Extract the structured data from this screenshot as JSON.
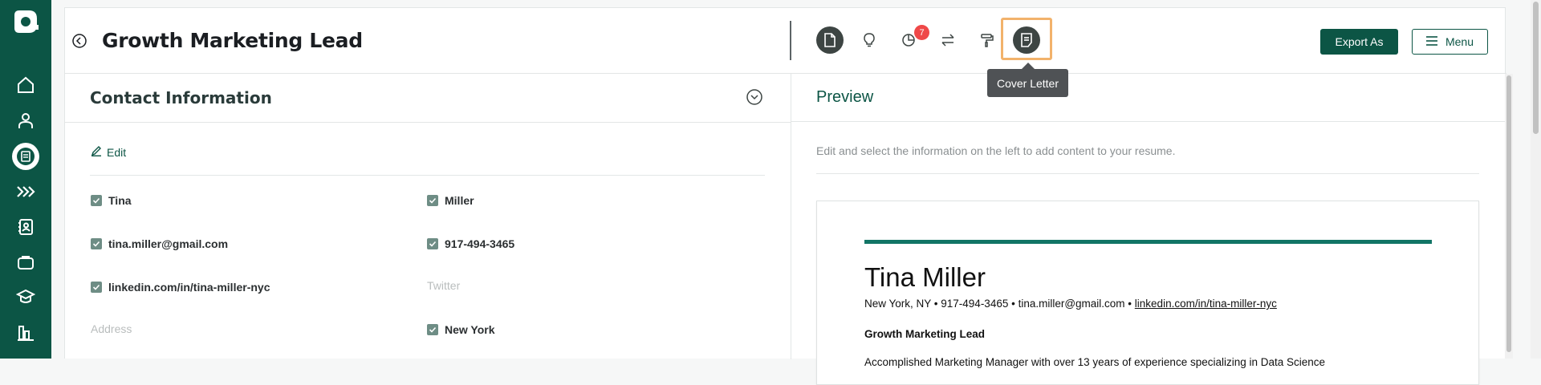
{
  "sidebar": {
    "items": [
      {
        "icon": "home-icon"
      },
      {
        "icon": "user-icon"
      },
      {
        "icon": "resume-icon",
        "active": true
      },
      {
        "icon": "chevrons-right-icon"
      },
      {
        "icon": "contacts-icon"
      },
      {
        "icon": "briefcase-icon"
      },
      {
        "icon": "graduation-cap-icon"
      },
      {
        "icon": "bar-chart-icon"
      }
    ]
  },
  "header": {
    "title": "Growth Marketing Lead",
    "notification_count": "7",
    "tooltip": "Cover Letter",
    "export_label": "Export As",
    "menu_label": "Menu",
    "toolbar_icons": [
      "document-icon",
      "lightbulb-icon",
      "pie-chart-icon",
      "swap-icon",
      "paint-roller-icon",
      "cover-letter-icon"
    ]
  },
  "contact": {
    "section_title": "Contact Information",
    "edit_label": "Edit",
    "first_name": "Tina",
    "last_name": "Miller",
    "email": "tina.miller@gmail.com",
    "phone": "917-494-3465",
    "linkedin": "linkedin.com/in/tina-miller-nyc",
    "twitter_placeholder": "Twitter",
    "address_placeholder": "Address",
    "city": "New York"
  },
  "preview": {
    "title": "Preview",
    "hint": "Edit and select the information on the left to add content to your resume.",
    "resume": {
      "name": "Tina Miller",
      "contact_prefix": "New York, NY • 917-494-3465 • tina.miller@gmail.com • ",
      "contact_link": "linkedin.com/in/tina-miller-nyc",
      "role": "Growth Marketing Lead",
      "summary": "Accomplished Marketing Manager with over 13 years of experience specializing in Data Science"
    }
  },
  "colors": {
    "brand": "#0c5545",
    "accent_bar": "#127566",
    "highlight": "#f2b26b",
    "badge": "#ef4848"
  }
}
